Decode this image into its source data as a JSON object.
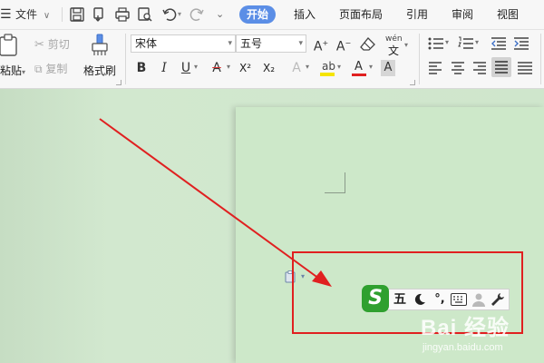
{
  "menubar": {
    "menu_icon": "hamburger-icon",
    "file_label": "文件",
    "tabs": [
      {
        "label": "开始",
        "active": true
      },
      {
        "label": "插入",
        "active": false
      },
      {
        "label": "页面布局",
        "active": false
      },
      {
        "label": "引用",
        "active": false
      },
      {
        "label": "审阅",
        "active": false
      },
      {
        "label": "视图",
        "active": false
      }
    ]
  },
  "ribbon": {
    "paste_label": "粘贴",
    "cut_label": "剪切",
    "copy_label": "复制",
    "format_painter_label": "格式刷",
    "font_name": "宋体",
    "font_size": "五号",
    "superscript": "X²",
    "subscript": "X₂",
    "pinyin_label": "wén"
  },
  "ime": {
    "logo": "S",
    "mode": "五",
    "punct": "°,",
    "icons": [
      "moon-icon",
      "keyboard-icon",
      "user-icon",
      "wrench-icon"
    ]
  },
  "watermark": {
    "brand": "Bai 经验",
    "url": "jingyan.baidu.com"
  },
  "colors": {
    "active_tab": "#5b8ee6",
    "annotation": "#e02020",
    "ime_logo": "#2fa02f",
    "background": "#cfe6cc"
  }
}
